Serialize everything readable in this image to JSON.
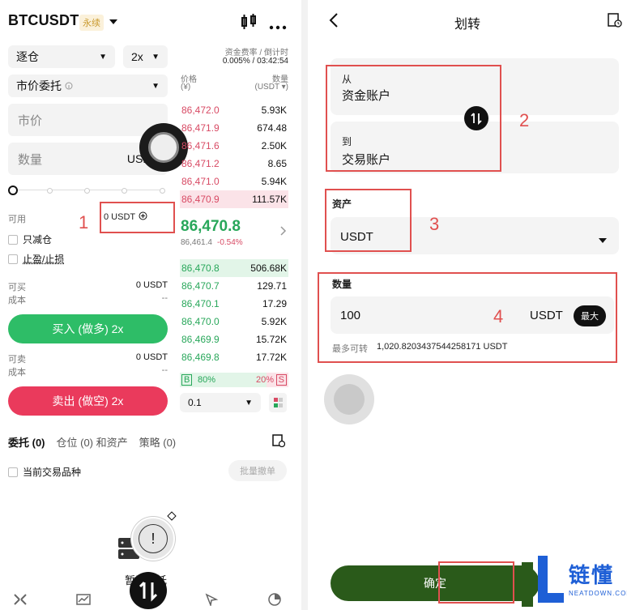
{
  "left": {
    "symbol": "BTCUSDT",
    "perp_badge": "永续",
    "margin_mode": "逐仓",
    "leverage": "2x",
    "funding_label": "资金费率 / 倒计时",
    "funding_value": "0.005% / 03:42:54",
    "order_type": "市价委托",
    "price_placeholder": "市价",
    "qty_placeholder": "数量",
    "qty_unit": "USDT",
    "orderbook_header_price": "价格",
    "orderbook_header_price_unit": "(¥)",
    "orderbook_header_qty": "数量",
    "orderbook_header_qty_unit": "(USDT ▾)",
    "asks": [
      {
        "price": "86,472.0",
        "qty": "5.93K"
      },
      {
        "price": "86,471.9",
        "qty": "674.48"
      },
      {
        "price": "86,471.6",
        "qty": "2.50K"
      },
      {
        "price": "86,471.2",
        "qty": "8.65"
      },
      {
        "price": "86,471.0",
        "qty": "5.94K"
      },
      {
        "price": "86,470.9",
        "qty": "111.57K"
      }
    ],
    "last_price": "86,470.8",
    "mark_price": "86,461.4",
    "change_pct": "-0.54%",
    "bids": [
      {
        "price": "86,470.8",
        "qty": "506.68K"
      },
      {
        "price": "86,470.7",
        "qty": "129.71"
      },
      {
        "price": "86,470.1",
        "qty": "17.29"
      },
      {
        "price": "86,470.0",
        "qty": "5.92K"
      },
      {
        "price": "86,469.9",
        "qty": "15.72K"
      },
      {
        "price": "86,469.8",
        "qty": "17.72K"
      }
    ],
    "available_label": "可用",
    "available_value": "0 USDT",
    "reduce_only": "只减仓",
    "tp_sl": "止盈/止损",
    "can_buy_label": "可买",
    "can_buy_value": "0 USDT",
    "cost_label": "成本",
    "cost_value": "--",
    "buy_button": "买入 (做多) 2x",
    "can_sell_label": "可卖",
    "can_sell_value": "0 USDT",
    "cost_label_2": "成本",
    "cost_value_2": "--",
    "sell_button": "卖出 (做空) 2x",
    "buy_ratio": "80%",
    "sell_ratio": "20%",
    "b_letter": "B",
    "s_letter": "S",
    "depth_step": "0.1",
    "tabs": [
      "委托 (0)",
      "仓位 (0) 和资产",
      "策略 (0)"
    ],
    "current_symbol_only": "当前交易品种",
    "batch_cancel": "批量撤单",
    "empty_text": "暂无委托",
    "annot_1": "1"
  },
  "right": {
    "title": "划转",
    "from_label": "从",
    "from_account": "资金账户",
    "to_label": "到",
    "to_account": "交易账户",
    "asset_label": "资产",
    "asset_value": "USDT",
    "amount_label": "数量",
    "amount_value": "100",
    "amount_unit": "USDT",
    "max_button": "最大",
    "max_transfer_label": "最多可转",
    "max_transfer_value": "1,020.8203437544258171 USDT",
    "confirm_button": "确定",
    "annot_2": "2",
    "annot_3": "3",
    "annot_4": "4",
    "watermark_brand": "链懂",
    "watermark_url": "NEATDOWN.COM"
  },
  "colors": {
    "buy_green": "#2ebd67",
    "sell_red": "#ea3a5c",
    "annotation_red": "#e0504f",
    "confirm_green": "#2a5a1a"
  }
}
